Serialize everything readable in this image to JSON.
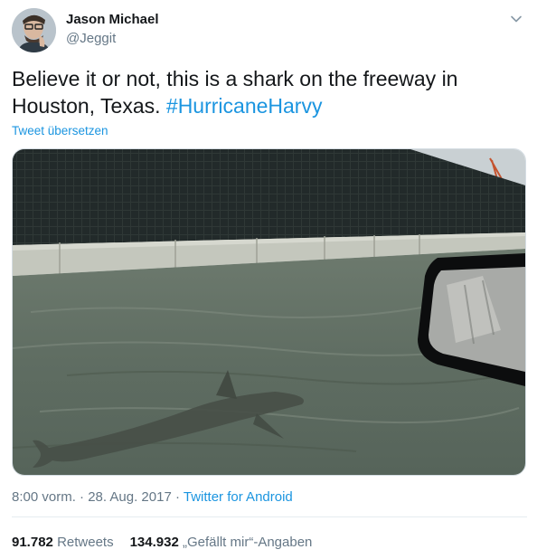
{
  "author": {
    "name": "Jason Michael",
    "handle": "@Jeggit"
  },
  "tweet": {
    "text": "Believe it or not, this is a shark on the freeway in Houston, Texas. ",
    "hashtag": "#HurricaneHarvy",
    "translate_link": "Tweet übersetzen"
  },
  "meta": {
    "time": "8:00 vorm.",
    "separator": " · ",
    "date": "28. Aug. 2017",
    "client": "Twitter for Android"
  },
  "stats": {
    "retweets_count": "91.782",
    "retweets_label": "Retweets",
    "likes_count": "134.932",
    "likes_label": "„Gefällt mir“-Angaben"
  },
  "icons": {
    "menu": "chevron-down-icon"
  },
  "colors": {
    "link": "#1b95e0",
    "text": "#14171a",
    "secondary": "#657786"
  }
}
